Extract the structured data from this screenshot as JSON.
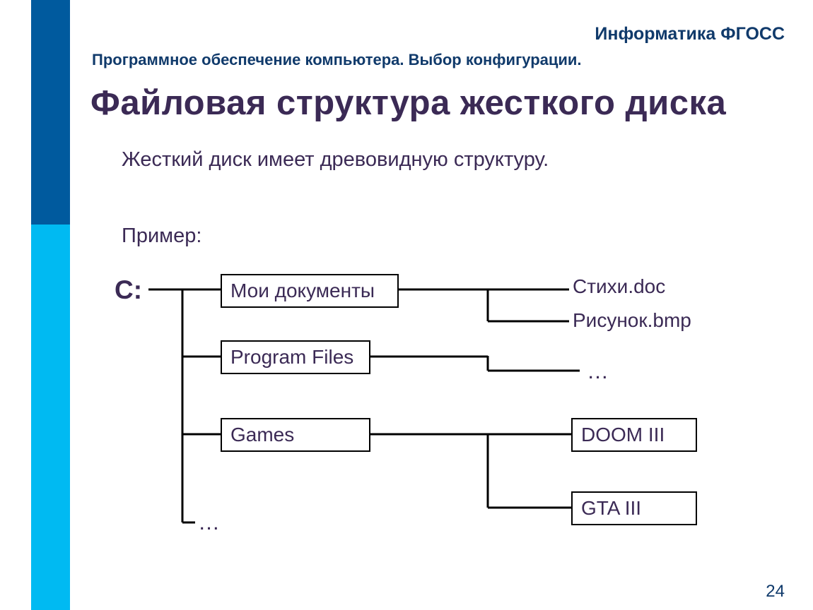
{
  "header": {
    "subject": "Информатика ФГОСС",
    "subtitle": "Программное обеспечение компьютера. Выбор конфигурации.",
    "title": "Файловая структура жесткого диска"
  },
  "body": {
    "description": "Жесткий диск имеет древовидную структуру.",
    "example_label": "Пример:",
    "root": "C:",
    "folders": {
      "docs": "Мои документы",
      "program_files": "Program Files",
      "games": "Games"
    },
    "files": {
      "doc1": "Стихи.doc",
      "doc2": "Рисунок.bmp"
    },
    "subfolders": {
      "doom": "DOOM III",
      "gta": "GTA III"
    },
    "ellipsis_pf": "…",
    "ellipsis_root": "…"
  },
  "pagenum": "24"
}
